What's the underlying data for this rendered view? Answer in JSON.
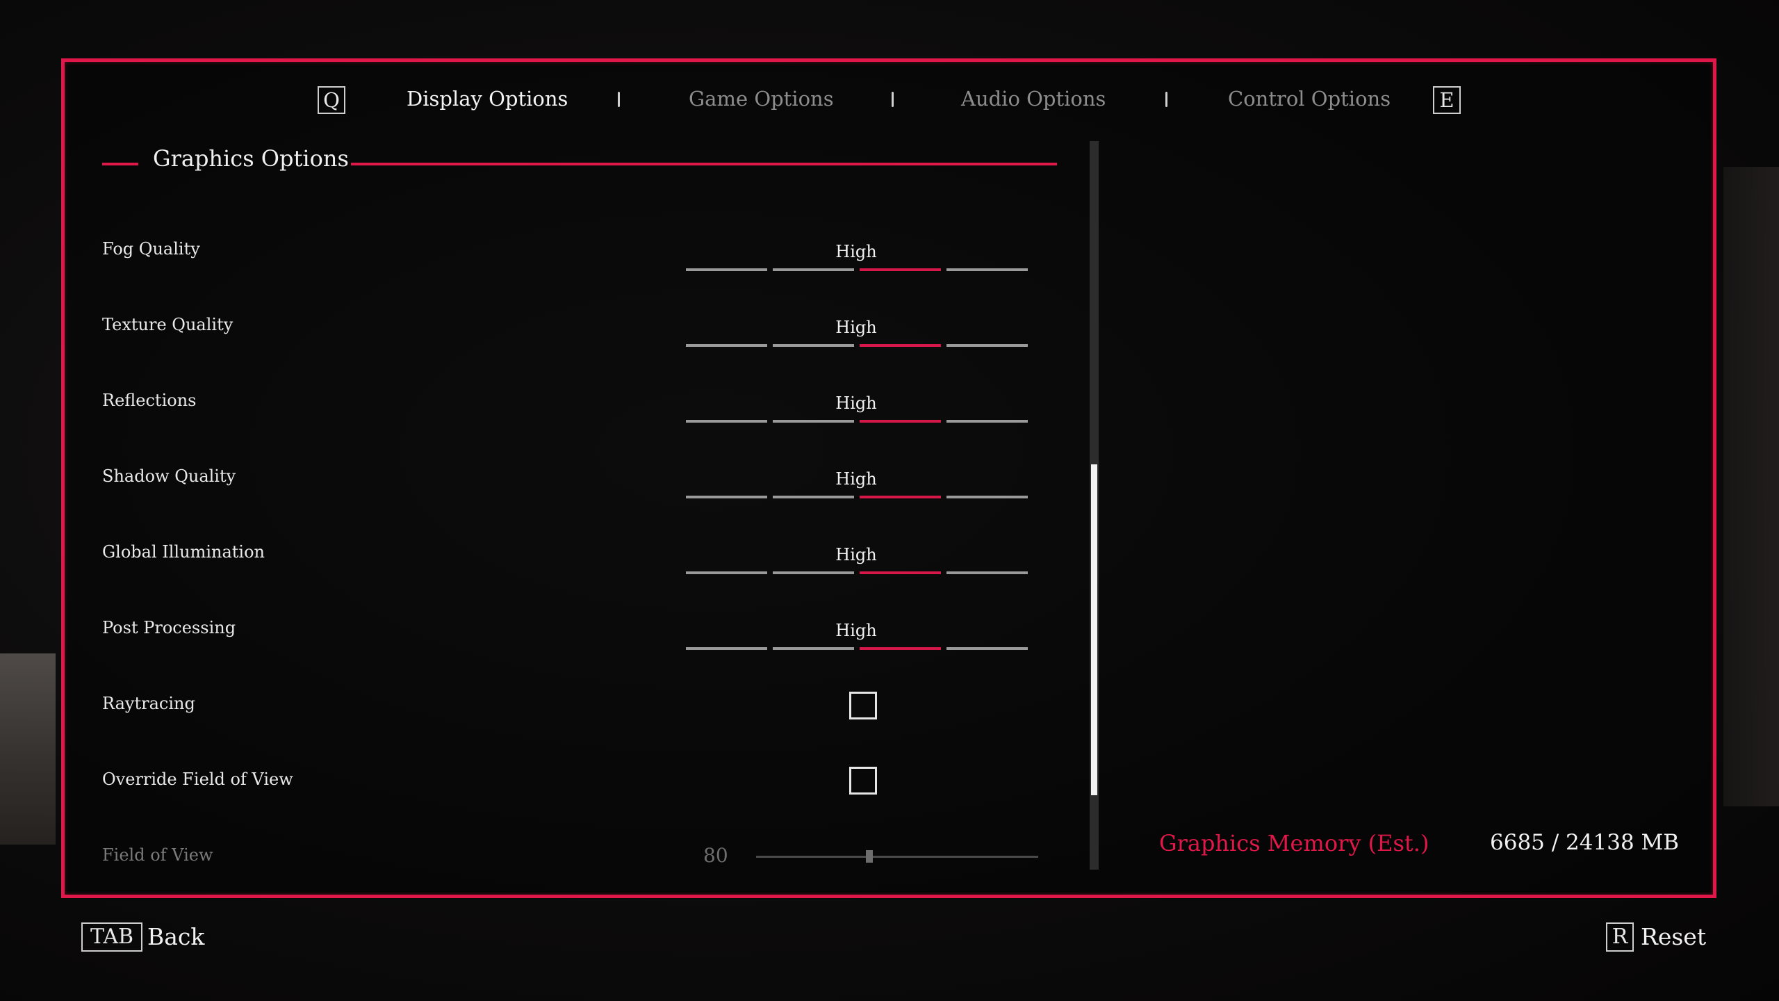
{
  "tabs": {
    "prev_key": "Q",
    "next_key": "E",
    "items": [
      {
        "label": "Display Options",
        "active": true
      },
      {
        "label": "Game Options",
        "active": false
      },
      {
        "label": "Audio Options",
        "active": false
      },
      {
        "label": "Control Options",
        "active": false
      }
    ]
  },
  "section": {
    "title": "Graphics Options"
  },
  "settings": [
    {
      "label": "Fog Quality",
      "value": "High",
      "selected_index": 2,
      "segments": 4
    },
    {
      "label": "Texture Quality",
      "value": "High",
      "selected_index": 2,
      "segments": 4
    },
    {
      "label": "Reflections",
      "value": "High",
      "selected_index": 2,
      "segments": 4
    },
    {
      "label": "Shadow Quality",
      "value": "High",
      "selected_index": 2,
      "segments": 4
    },
    {
      "label": "Global Illumination",
      "value": "High",
      "selected_index": 2,
      "segments": 4
    },
    {
      "label": "Post Processing",
      "value": "High",
      "selected_index": 2,
      "segments": 4
    },
    {
      "label": "Raytracing",
      "checked": false
    },
    {
      "label": "Override Field of View",
      "checked": false
    },
    {
      "label": "Field of View",
      "value": "80",
      "slider_fraction": 0.4,
      "disabled": true
    }
  ],
  "graphics_memory": {
    "label": "Graphics Memory (Est.)",
    "value": "6685 / 24138 MB"
  },
  "footer": {
    "back_key": "TAB",
    "back_label": "Back",
    "reset_key": "R",
    "reset_label": "Reset"
  },
  "colors": {
    "accent": "#e01849",
    "active_segment": "#d6174a",
    "inactive_segment": "#9a9a9a"
  }
}
